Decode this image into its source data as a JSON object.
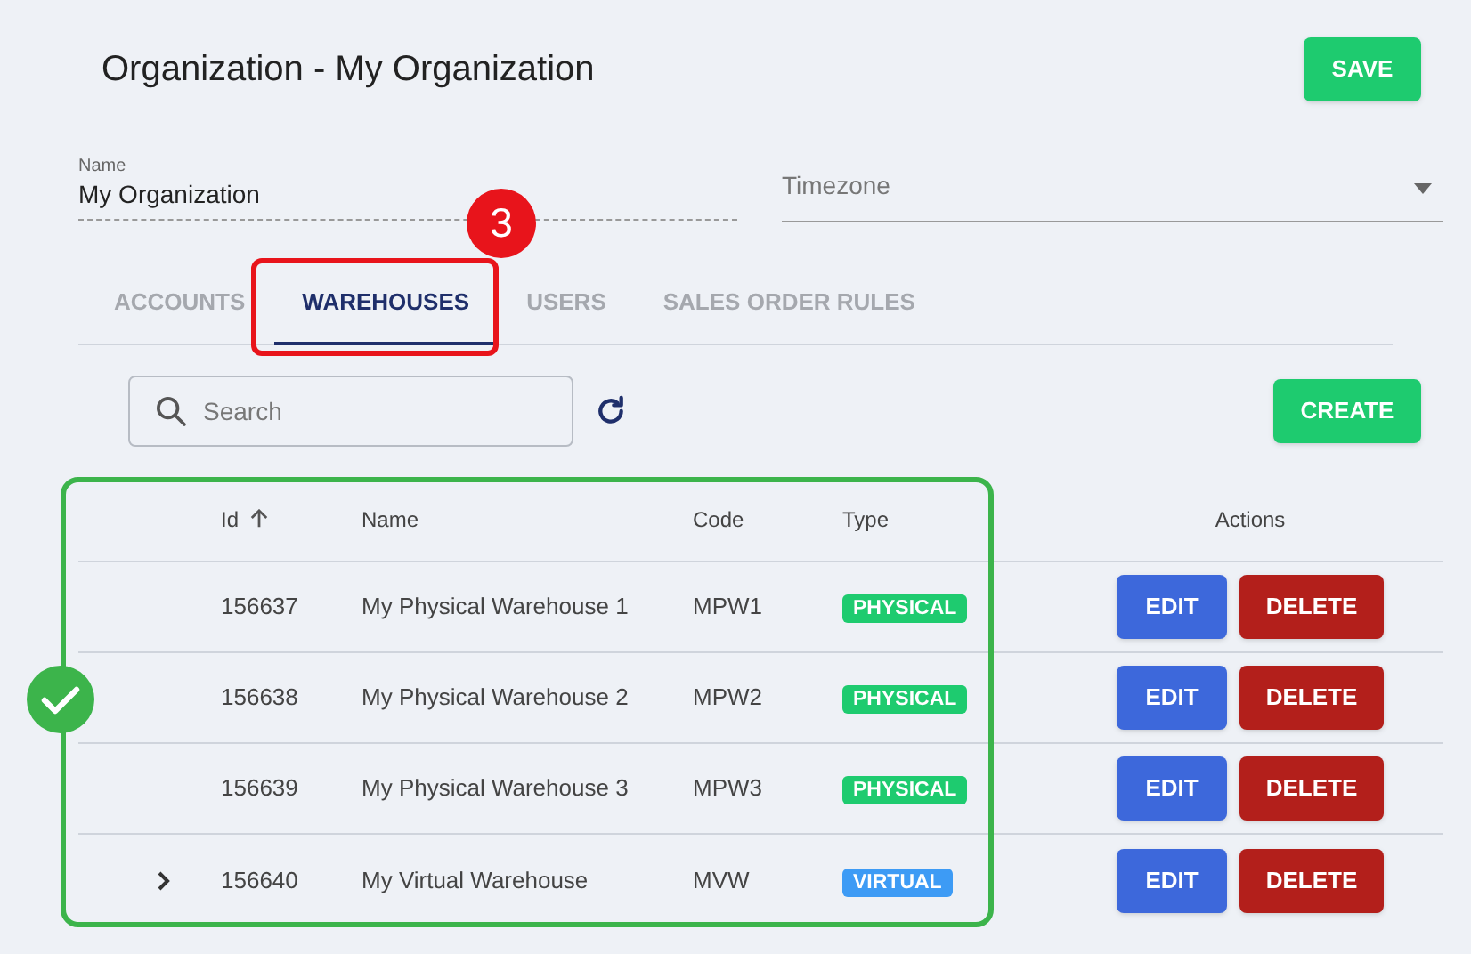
{
  "header": {
    "title": "Organization - My Organization",
    "save_button": "SAVE"
  },
  "form": {
    "name": {
      "label": "Name",
      "value": "My Organization"
    },
    "timezone": {
      "placeholder": "Timezone"
    }
  },
  "tabs": [
    {
      "label": "ACCOUNTS",
      "selected": false
    },
    {
      "label": "WAREHOUSES",
      "selected": true
    },
    {
      "label": "USERS",
      "selected": false
    },
    {
      "label": "SALES ORDER RULES",
      "selected": false
    }
  ],
  "toolbar": {
    "search": {
      "placeholder": "Search"
    },
    "create_button": "CREATE"
  },
  "table": {
    "columns": [
      {
        "label": "Id",
        "sorted": true
      },
      {
        "label": "Name",
        "sorted": false
      },
      {
        "label": "Code",
        "sorted": false
      },
      {
        "label": "Type",
        "sorted": false
      },
      {
        "label": "Actions",
        "sorted": false
      }
    ],
    "rows": [
      {
        "expandable": false,
        "id": "156637",
        "name": "My Physical Warehouse 1",
        "code": "MPW1",
        "type": {
          "label": "PHYSICAL",
          "kind": "physical"
        },
        "edit": "EDIT",
        "delete": "DELETE"
      },
      {
        "expandable": false,
        "id": "156638",
        "name": "My Physical Warehouse 2",
        "code": "MPW2",
        "type": {
          "label": "PHYSICAL",
          "kind": "physical"
        },
        "edit": "EDIT",
        "delete": "DELETE"
      },
      {
        "expandable": false,
        "id": "156639",
        "name": "My Physical Warehouse 3",
        "code": "MPW3",
        "type": {
          "label": "PHYSICAL",
          "kind": "physical"
        },
        "edit": "EDIT",
        "delete": "DELETE"
      },
      {
        "expandable": true,
        "id": "156640",
        "name": "My Virtual Warehouse",
        "code": "MVW",
        "type": {
          "label": "VIRTUAL",
          "kind": "virtual"
        },
        "edit": "EDIT",
        "delete": "DELETE"
      }
    ]
  },
  "annotations": [
    {
      "kind": "tab-highlight",
      "color": "#e8141b",
      "badge": "3"
    },
    {
      "kind": "table-highlight",
      "color": "#3cb44b"
    }
  ]
}
